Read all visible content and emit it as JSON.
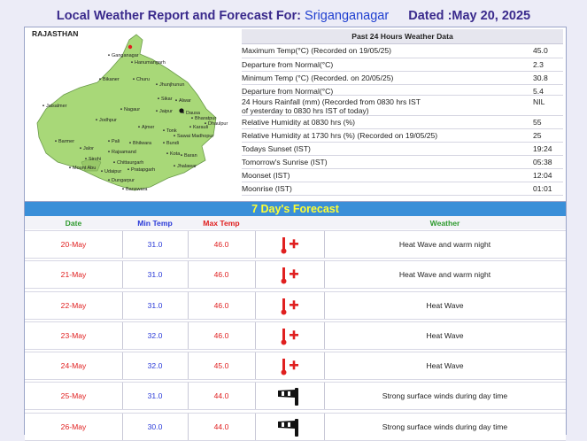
{
  "header": {
    "prefix": "Local Weather Report and Forecast For:",
    "location": "Sriganganagar",
    "date_text": "Dated :May 20, 2025"
  },
  "map": {
    "state": "RAJASTHAN",
    "places": [
      "Ganganagar",
      "Hanumangarh",
      "Bikaner",
      "Churu",
      "Jhunjhunun",
      "Sikar",
      "Alwar",
      "Jaisalmer",
      "Nagaur",
      "Jaipur",
      "Dausa",
      "Bharatpur",
      "Dhaulpur",
      "Karauli",
      "Jodhpur",
      "Ajmer",
      "Tonk",
      "Sawai Madhopur",
      "Barmer",
      "Pali",
      "Bhilwara",
      "Bundi",
      "Kota",
      "Baran",
      "Jalor",
      "Rajsamand",
      "Chittaurgarh",
      "Jhalawar",
      "Sirohi",
      "Mount Abu",
      "Udaipur",
      "Pratapgarh",
      "Dungarpur",
      "Banswara"
    ]
  },
  "past24": {
    "title": "Past 24 Hours Weather Data",
    "rows": [
      {
        "label": "Maximum Temp(°C) (Recorded on 19/05/25)",
        "value": "45.0"
      },
      {
        "label": "Departure from Normal(°C)",
        "value": "2.3"
      },
      {
        "label": "Minimum Temp (°C) (Recorded. on 20/05/25)",
        "value": "30.8"
      },
      {
        "label": "Departure from Normal(°C)",
        "value": "5.4"
      },
      {
        "label": "24 Hours Rainfall (mm) (Recorded from 0830 hrs IST",
        "label2": "of yesterday to 0830 hrs IST of today)",
        "value": "NIL"
      },
      {
        "label": "Relative Humidity at 0830 hrs (%)",
        "value": "55"
      },
      {
        "label": "Relative Humidity at 1730 hrs (%) (Recorded on 19/05/25)",
        "value": "25"
      },
      {
        "label": "Todays Sunset (IST)",
        "value": "19:24"
      },
      {
        "label": "Tomorrow's Sunrise (IST)",
        "value": "05:38"
      },
      {
        "label": "Moonset (IST)",
        "value": "12:04"
      },
      {
        "label": "Moonrise (IST)",
        "value": "01:01"
      }
    ]
  },
  "forecast": {
    "title": "7 Day's Forecast",
    "headers": {
      "date": "Date",
      "min": "Min Temp",
      "max": "Max Temp",
      "weather": "Weather"
    },
    "colors": {
      "date": "#2e9a2e",
      "min": "#2a3ad8",
      "max": "#e02020",
      "band": "#3a8fd8",
      "band_text": "#ffff33"
    },
    "rows": [
      {
        "date": "20-May",
        "min": "31.0",
        "max": "46.0",
        "icon": "thermometer-hot-icon",
        "weather": "Heat Wave and warm night"
      },
      {
        "date": "21-May",
        "min": "31.0",
        "max": "46.0",
        "icon": "thermometer-hot-icon",
        "weather": "Heat Wave and warm night"
      },
      {
        "date": "22-May",
        "min": "31.0",
        "max": "46.0",
        "icon": "thermometer-hot-icon",
        "weather": "Heat Wave"
      },
      {
        "date": "23-May",
        "min": "32.0",
        "max": "46.0",
        "icon": "thermometer-hot-icon",
        "weather": "Heat Wave"
      },
      {
        "date": "24-May",
        "min": "32.0",
        "max": "45.0",
        "icon": "thermometer-hot-icon",
        "weather": "Heat Wave"
      },
      {
        "date": "25-May",
        "min": "31.0",
        "max": "44.0",
        "icon": "wind-sock-icon",
        "weather": "Strong surface winds during day time"
      },
      {
        "date": "26-May",
        "min": "30.0",
        "max": "44.0",
        "icon": "wind-sock-icon",
        "weather": "Strong surface winds during day time"
      }
    ]
  }
}
